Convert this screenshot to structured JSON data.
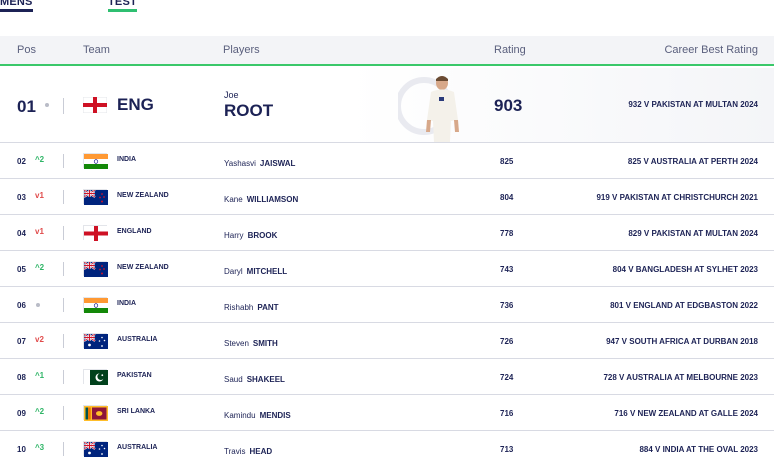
{
  "tabs": [
    {
      "label": "MENS"
    },
    {
      "label": "TEST"
    }
  ],
  "columns": {
    "pos": "Pos",
    "team": "Team",
    "players": "Players",
    "rating": "Rating",
    "best": "Career Best Rating"
  },
  "top": {
    "pos": "01",
    "movement": "none",
    "team": "ENG",
    "flag": "england",
    "first": "Joe",
    "last": "ROOT",
    "rating": "903",
    "best": "932 V PAKISTAN AT MULTAN 2024"
  },
  "rows": [
    {
      "pos": "02",
      "move": "up",
      "move_text": "^2",
      "team": "INDIA",
      "flag": "india",
      "first": "Yashasvi",
      "last": "JAISWAL",
      "rating": "825",
      "best": "825 V AUSTRALIA AT PERTH 2024"
    },
    {
      "pos": "03",
      "move": "down",
      "move_text": "v1",
      "team": "NEW ZEALAND",
      "flag": "new-zealand",
      "first": "Kane",
      "last": "WILLIAMSON",
      "rating": "804",
      "best": "919 V PAKISTAN AT CHRISTCHURCH 2021"
    },
    {
      "pos": "04",
      "move": "down",
      "move_text": "v1",
      "team": "ENGLAND",
      "flag": "england",
      "first": "Harry",
      "last": "BROOK",
      "rating": "778",
      "best": "829 V PAKISTAN AT MULTAN 2024"
    },
    {
      "pos": "05",
      "move": "up",
      "move_text": "^2",
      "team": "NEW ZEALAND",
      "flag": "new-zealand",
      "first": "Daryl",
      "last": "MITCHELL",
      "rating": "743",
      "best": "804 V BANGLADESH AT SYLHET 2023"
    },
    {
      "pos": "06",
      "move": "none",
      "move_text": "",
      "team": "INDIA",
      "flag": "india",
      "first": "Rishabh",
      "last": "PANT",
      "rating": "736",
      "best": "801 V ENGLAND AT EDGBASTON 2022"
    },
    {
      "pos": "07",
      "move": "down",
      "move_text": "v2",
      "team": "AUSTRALIA",
      "flag": "australia",
      "first": "Steven",
      "last": "SMITH",
      "rating": "726",
      "best": "947 V SOUTH AFRICA AT DURBAN 2018"
    },
    {
      "pos": "08",
      "move": "up",
      "move_text": "^1",
      "team": "PAKISTAN",
      "flag": "pakistan",
      "first": "Saud",
      "last": "SHAKEEL",
      "rating": "724",
      "best": "728 V AUSTRALIA AT MELBOURNE 2023"
    },
    {
      "pos": "09",
      "move": "up",
      "move_text": "^2",
      "team": "SRI LANKA",
      "flag": "sri-lanka",
      "first": "Kamindu",
      "last": "MENDIS",
      "rating": "716",
      "best": "716 V NEW ZEALAND AT GALLE 2024"
    },
    {
      "pos": "10",
      "move": "up",
      "move_text": "^3",
      "team": "AUSTRALIA",
      "flag": "australia",
      "first": "Travis",
      "last": "HEAD",
      "rating": "713",
      "best": "884 V INDIA AT THE OVAL 2023"
    }
  ],
  "colors": {
    "navy": "#1c2255",
    "accent_green": "#3ac86a",
    "up": "#2fb567",
    "down": "#e04a4a"
  }
}
